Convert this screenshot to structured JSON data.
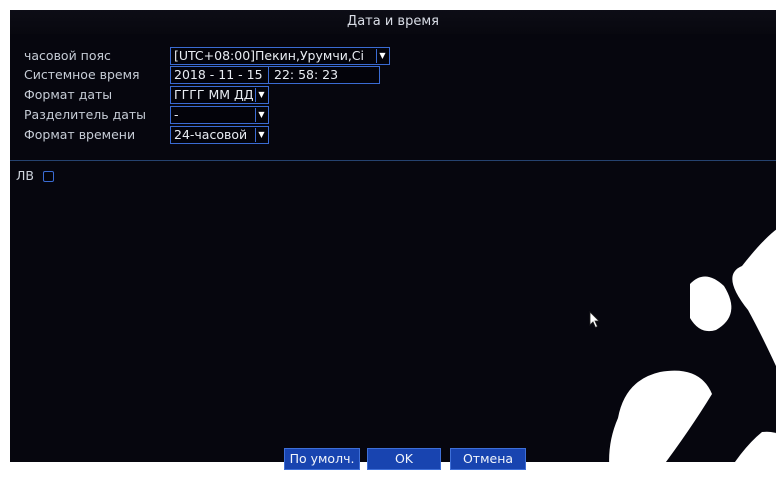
{
  "dialog": {
    "title": "Дата и время",
    "fields": {
      "timezone": {
        "label": "часовой пояс",
        "value": "[UTC+08:00]Пекин,Урумчи,Сі"
      },
      "system_time": {
        "label": "Системное время",
        "date": "2018 - 11 - 15",
        "time": "22: 58: 23"
      },
      "date_format": {
        "label": "Формат даты",
        "value": "ГГГГ ММ ДД"
      },
      "date_separator": {
        "label": "Разделитель даты",
        "value": "-"
      },
      "time_format": {
        "label": "Формат времени",
        "value": "24-часовой"
      }
    },
    "dst": {
      "label": "ЛВ",
      "checked": false
    },
    "buttons": {
      "default_label": "По умолч.",
      "ok_label": "OK",
      "cancel_label": "Отмена"
    }
  },
  "colors": {
    "dialog_bg": "#06060e",
    "field_border": "#3a6bd3",
    "button_bg": "#1844b0",
    "watermark": "#ffffff"
  },
  "icons": {
    "dropdown": "chevron-down-icon",
    "cursor": "mouse-pointer-icon"
  }
}
